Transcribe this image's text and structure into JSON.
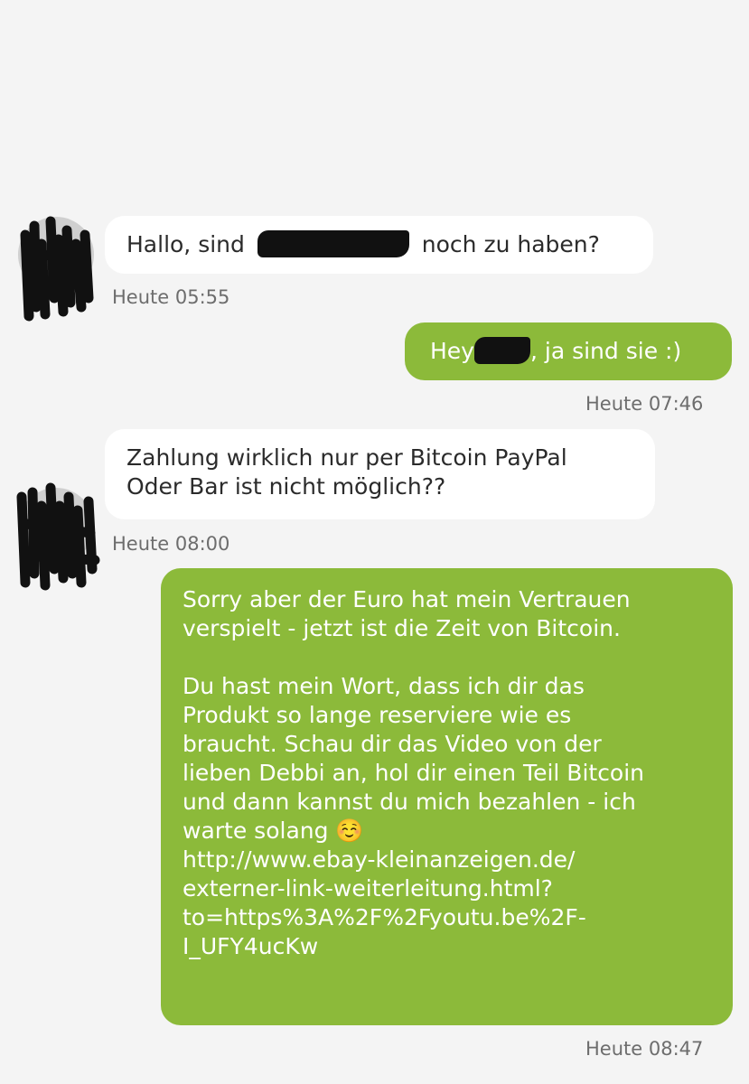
{
  "messages": [
    {
      "direction": "incoming",
      "text_before": "Hallo, sind",
      "text_after": "noch zu haben?",
      "time": "Heute 05:55"
    },
    {
      "direction": "outgoing",
      "text_before": "Hey",
      "text_after": ", ja sind sie :)",
      "time": "Heute 07:46"
    },
    {
      "direction": "incoming",
      "line1": "Zahlung wirklich nur per Bitcoin PayPal",
      "line2": "Oder Bar ist nicht möglich??",
      "time": "Heute 08:00"
    },
    {
      "direction": "outgoing",
      "para1_line1": "Sorry aber der Euro hat mein Vertrauen",
      "para1_line2": "verspielt - jetzt ist die Zeit von Bitcoin.",
      "para2_line1": "Du hast mein Wort, dass ich dir das",
      "para2_line2": "Produkt so lange reserviere wie es",
      "para2_line3": "braucht. Schau dir das Video von der",
      "para2_line4": "lieben Debbi an, hol dir einen Teil Bitcoin",
      "para2_line5": "und dann kannst du mich bezahlen - ich",
      "para2_line6": "warte solang ☺️",
      "link_line1": "http://www.ebay-kleinanzeigen.de/",
      "link_line2": "externer-link-weiterleitung.html?",
      "link_line3": "to=https%3A%2F%2Fyoutu.be%2F-",
      "link_line4": "I_UFY4ucKw",
      "time": "Heute 08:47"
    }
  ],
  "colors": {
    "background": "#f4f4f4",
    "incoming_bubble": "#ffffff",
    "outgoing_bubble": "#8cba3a",
    "timestamp": "#6d6d6d"
  }
}
